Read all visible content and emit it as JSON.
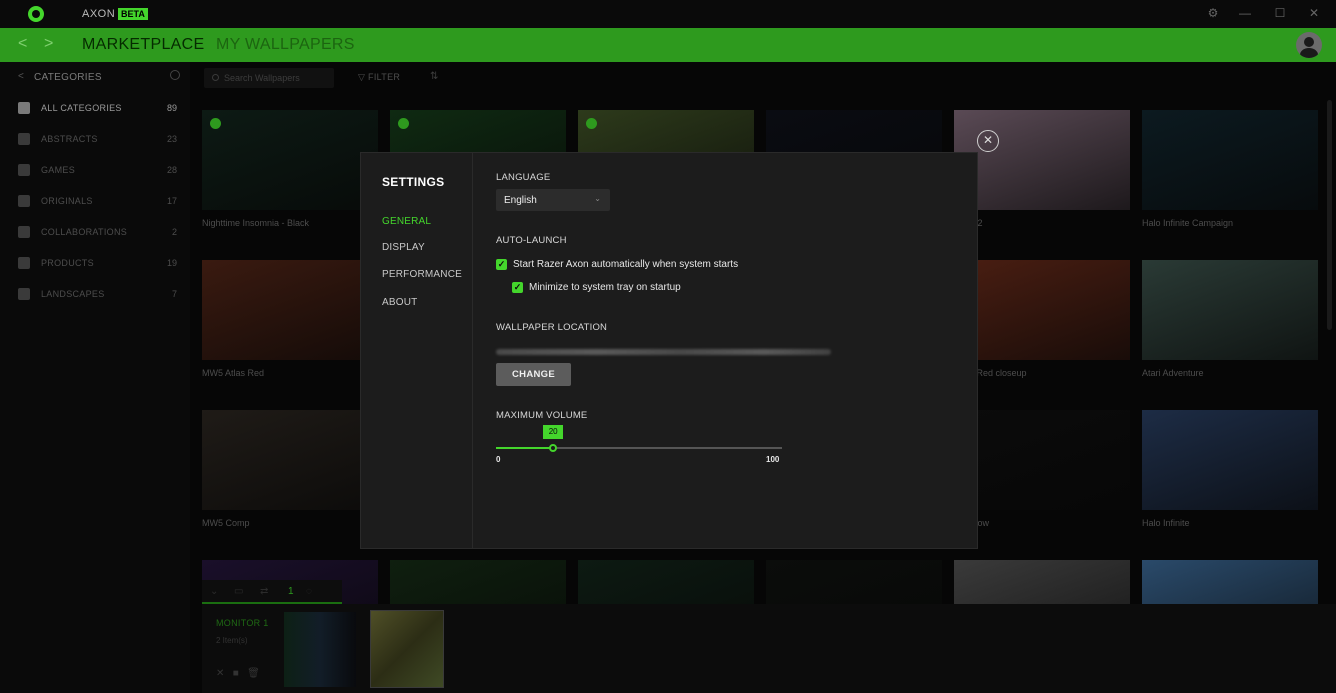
{
  "titlebar": {
    "app_name": "AXON",
    "beta_badge": "BETA",
    "controls": [
      "settings-icon",
      "minimize-icon",
      "maximize-icon",
      "close-icon"
    ]
  },
  "nav": {
    "back_icon": "chevron-left-icon",
    "forward_icon": "chevron-right-icon",
    "tabs": [
      {
        "label": "MARKETPLACE",
        "active": true
      },
      {
        "label": "MY WALLPAPERS",
        "active": false
      }
    ],
    "profile_icon": "user-avatar-icon"
  },
  "sidebar": {
    "header": "CATEGORIES",
    "items": [
      {
        "label": "ALL CATEGORIES",
        "count": "89",
        "icon": "grid-icon",
        "active": true
      },
      {
        "label": "ABSTRACTS",
        "count": "23",
        "icon": "gem-icon",
        "active": false
      },
      {
        "label": "GAMES",
        "count": "28",
        "icon": "gamepad-icon",
        "active": false
      },
      {
        "label": "ORIGINALS",
        "count": "17",
        "icon": "palette-icon",
        "active": false
      },
      {
        "label": "COLLABORATIONS",
        "count": "2",
        "icon": "collab-icon",
        "active": false
      },
      {
        "label": "PRODUCTS",
        "count": "19",
        "icon": "mouse-icon",
        "active": false
      },
      {
        "label": "LANDSCAPES",
        "count": "7",
        "icon": "mountain-icon",
        "active": false
      }
    ]
  },
  "toolbar": {
    "search_placeholder": "Search Wallpapers",
    "filter_label": "FILTER",
    "sort_icon": "sort-icon"
  },
  "grid": {
    "cards": [
      {
        "title": "Nighttime Insomnia - Black",
        "color": "#0d1a14"
      },
      {
        "title": "",
        "color": "#0f2a12"
      },
      {
        "title": "",
        "color": "#2d3a1b"
      },
      {
        "title": "",
        "color": "#0a0c12"
      },
      {
        "title": "Lair V2",
        "color": "#5a4a55"
      },
      {
        "title": "Halo Infinite Campaign",
        "color": "#0c1a20"
      },
      {
        "title": "MW5 Atlas Red",
        "color": "#3a1a10"
      },
      {
        "title": "",
        "color": "#141414"
      },
      {
        "title": "",
        "color": "#141414"
      },
      {
        "title": "",
        "color": "#141414"
      },
      {
        "title": "Atlas Red closeup",
        "color": "#4a1e12"
      },
      {
        "title": "Atari Adventure",
        "color": "#2a3a35"
      },
      {
        "title": "MW5 Comp",
        "color": "#1f1b17"
      },
      {
        "title": "",
        "color": "#141414"
      },
      {
        "title": "",
        "color": "#141414"
      },
      {
        "title": "",
        "color": "#141414"
      },
      {
        "title": "Rainbow",
        "color": "#0b0b0b"
      },
      {
        "title": "Halo Infinite",
        "color": "#1d2c45"
      },
      {
        "title": "",
        "color": "#1a0f2a"
      },
      {
        "title": "",
        "color": "#0f1f0f"
      },
      {
        "title": "",
        "color": "#0d1a12"
      },
      {
        "title": "",
        "color": "#0b0d0b"
      },
      {
        "title": "",
        "color": "#3a3a3a"
      },
      {
        "title": "",
        "color": "#2a4a6a"
      }
    ]
  },
  "monitor": {
    "tab_number": "1",
    "name": "MONITOR 1",
    "item_count": "2 Item(s)"
  },
  "settings": {
    "heading": "SETTINGS",
    "nav": [
      {
        "label": "GENERAL",
        "active": true
      },
      {
        "label": "DISPLAY",
        "active": false
      },
      {
        "label": "PERFORMANCE",
        "active": false
      },
      {
        "label": "ABOUT",
        "active": false
      }
    ],
    "language": {
      "label": "LANGUAGE",
      "value": "English"
    },
    "auto_launch": {
      "label": "AUTO-LAUNCH",
      "start_option": "Start Razer Axon automatically when system starts",
      "start_checked": true,
      "minimize_option": "Minimize to system tray on startup",
      "minimize_checked": true
    },
    "wallpaper_location": {
      "label": "WALLPAPER LOCATION",
      "change_button": "CHANGE"
    },
    "max_volume": {
      "label": "MAXIMUM VOLUME",
      "value": "20",
      "min": "0",
      "max": "100"
    },
    "close_icon": "close-circle-icon"
  },
  "colors": {
    "accent": "#44d62c",
    "nav_green": "#2e9a1e"
  }
}
